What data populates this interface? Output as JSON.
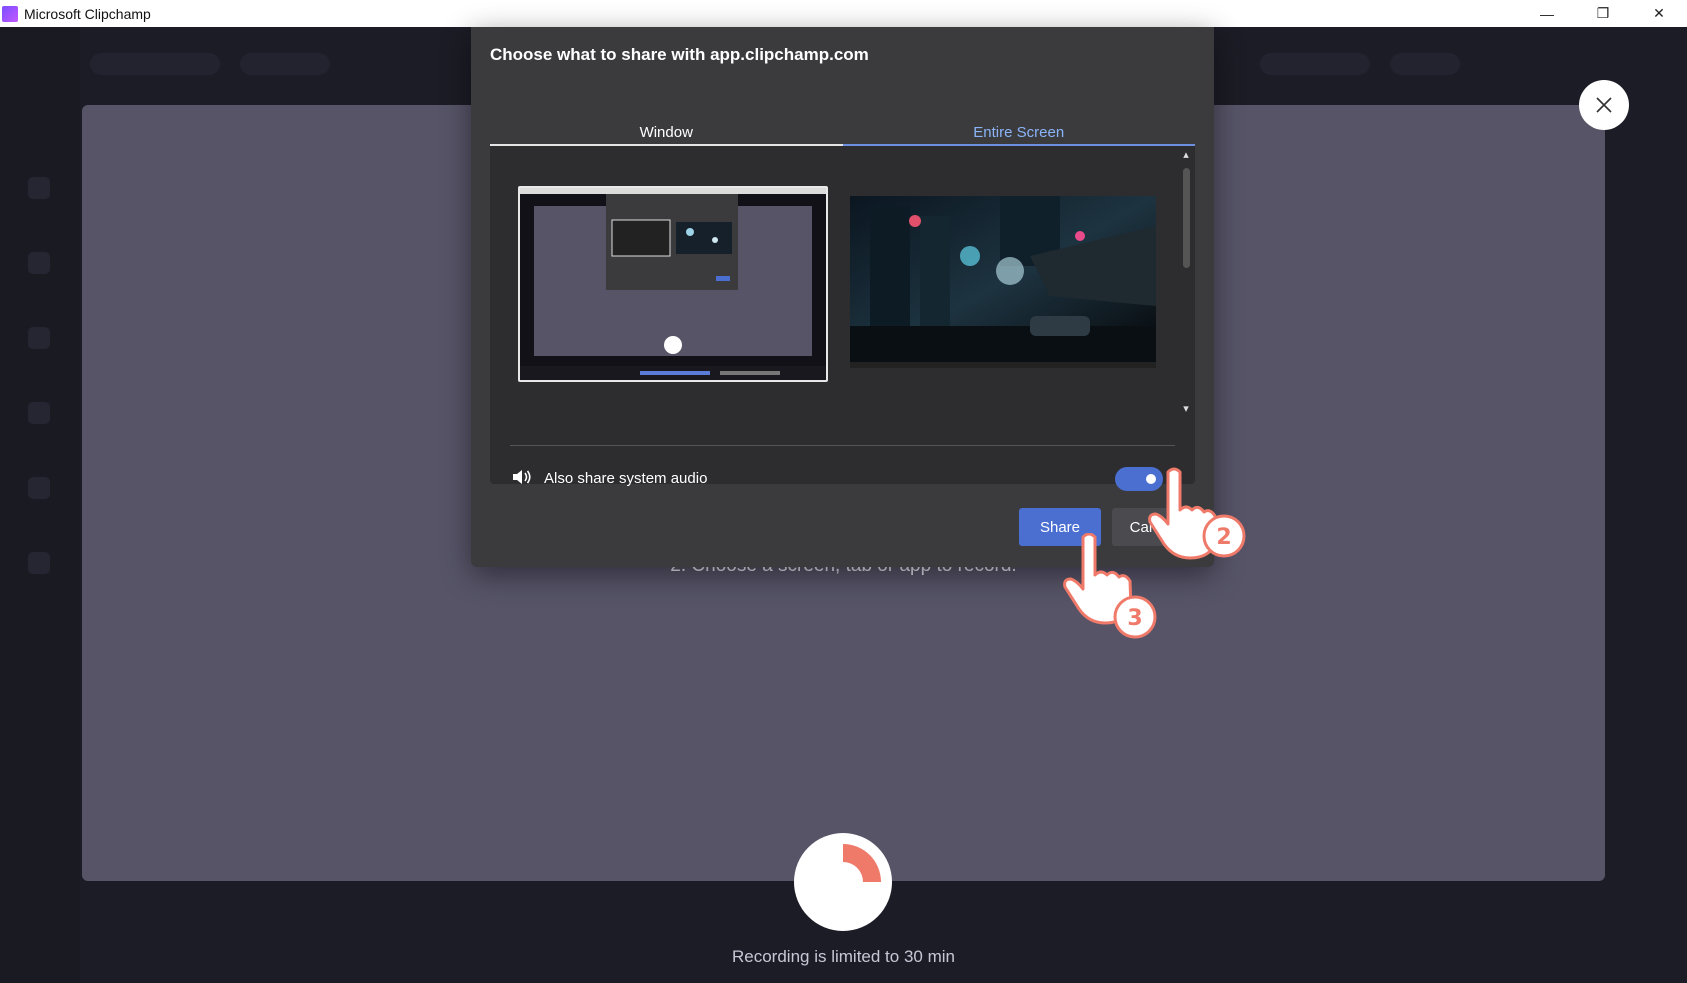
{
  "window": {
    "title": "Microsoft Clipchamp",
    "controls": {
      "minimize": "—",
      "restore": "❐",
      "close": "✕"
    }
  },
  "dialog": {
    "title": "Choose what to share with app.clipchamp.com",
    "tabs": [
      {
        "label": "Window",
        "selected": false
      },
      {
        "label": "Entire Screen",
        "selected": true
      }
    ],
    "audio_label": "Also share system audio",
    "audio_enabled": true,
    "share_label": "Share",
    "cancel_label": "Cancel"
  },
  "stage": {
    "step_text": "2. Choose a screen, tab or app to record.",
    "limit_text": "Recording is limited to 30 min"
  },
  "annotations": {
    "step_2": "2",
    "step_3": "3"
  },
  "colors": {
    "accent": "#4a6fd1",
    "annotation": "#f07a6a",
    "stage": "#575468"
  },
  "icons": [
    "app-logo-icon",
    "speaker-icon",
    "close-icon",
    "pointer-hand-icon",
    "record-icon"
  ]
}
